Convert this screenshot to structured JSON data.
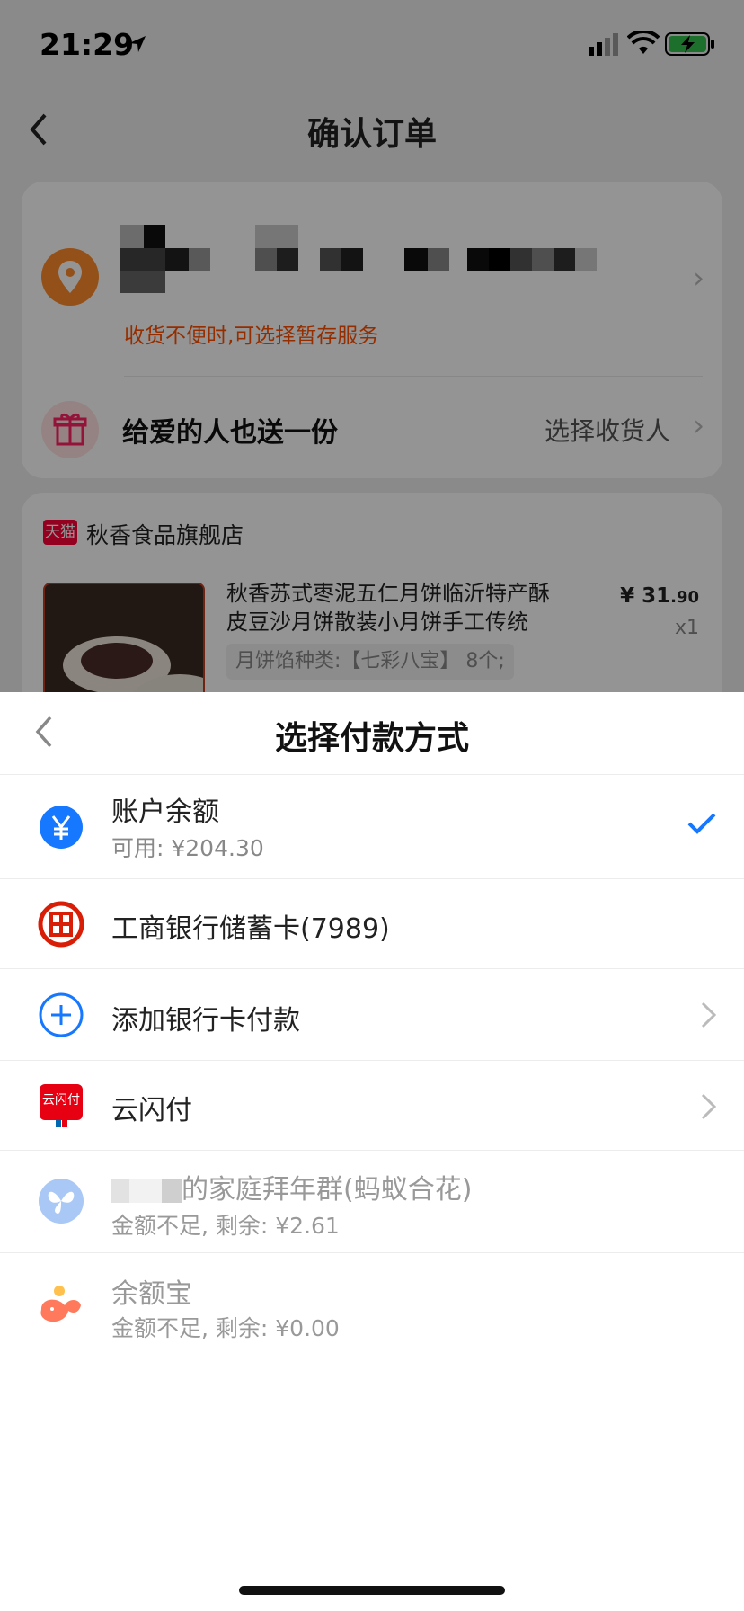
{
  "status_bar": {
    "time": "21:29"
  },
  "nav": {
    "title": "确认订单"
  },
  "address": {
    "hint": "收货不便时,可选择暂存服务"
  },
  "gift": {
    "text": "给爱的人也送一份",
    "action": "选择收货人"
  },
  "shop": {
    "badge": "天猫",
    "name": "秋香食品旗舰店"
  },
  "product": {
    "title": "秋香苏式枣泥五仁月饼临沂特产酥皮豆沙月饼散装小月饼手工传统",
    "price_symbol": "¥",
    "price_int": "31",
    "price_dec": ".90",
    "qty": "x1",
    "spec": "月饼馅种类:【七彩八宝】 8个;"
  },
  "sheet": {
    "title": "选择付款方式",
    "options": [
      {
        "title": "账户余额",
        "sub": "可用: ¥204.30",
        "icon": "yuan-icon",
        "selected": true
      },
      {
        "title": "工商银行储蓄卡(7989)",
        "icon": "icbc-icon"
      },
      {
        "title": "添加银行卡付款",
        "icon": "plus-circle-icon"
      },
      {
        "title": "云闪付",
        "icon": "unionpay-icon"
      },
      {
        "title": "的家庭拜年群(蚂蚁合花)",
        "sub": "金额不足, 剩余: ¥2.61",
        "icon": "butterfly-icon"
      },
      {
        "title": "余额宝",
        "sub": "金额不足, 剩余: ¥0.00",
        "icon": "yuebao-icon"
      }
    ]
  },
  "colors": {
    "accent": "#1677ff",
    "warning": "#ff5000",
    "tmall": "#ff0036",
    "icbc": "#d81e06"
  }
}
